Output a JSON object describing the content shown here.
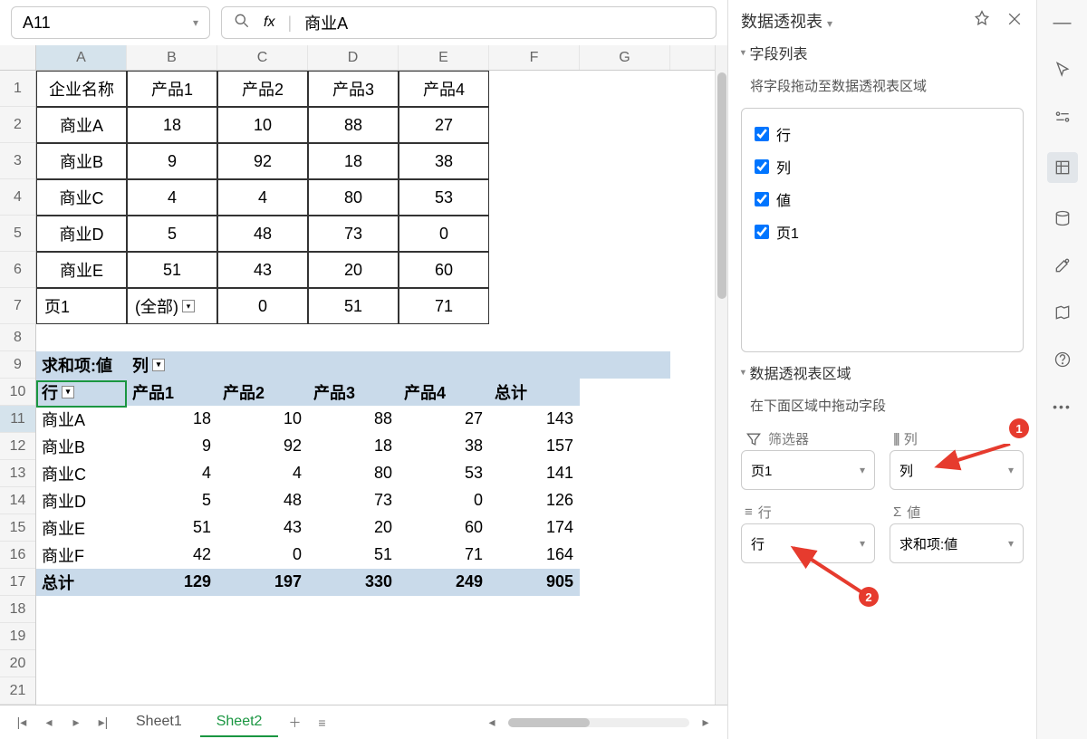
{
  "toolbar": {
    "cell_ref": "A11",
    "fx_label": "fx",
    "formula_value": "商业A"
  },
  "columns": [
    "A",
    "B",
    "C",
    "D",
    "E",
    "F",
    "G"
  ],
  "row_count": 22,
  "selected_row": 11,
  "selected_col_index": 0,
  "data_table": {
    "header": [
      "企业名称",
      "产品1",
      "产品2",
      "产品3",
      "产品4"
    ],
    "rows": [
      [
        "商业A",
        "18",
        "10",
        "88",
        "27"
      ],
      [
        "商业B",
        "9",
        "92",
        "18",
        "38"
      ],
      [
        "商业C",
        "4",
        "4",
        "80",
        "53"
      ],
      [
        "商业D",
        "5",
        "48",
        "73",
        "0"
      ],
      [
        "商业E",
        "51",
        "43",
        "20",
        "60"
      ]
    ],
    "page_label": "页1",
    "page_value": "(全部)",
    "extra_row": [
      "0",
      "51",
      "71"
    ]
  },
  "pivot": {
    "sum_label": "求和项:値",
    "col_label": "列",
    "row_label": "行",
    "col_headers": [
      "产品1",
      "产品2",
      "产品3",
      "产品4",
      "总计"
    ],
    "rows": [
      [
        "商业A",
        "18",
        "10",
        "88",
        "27",
        "143"
      ],
      [
        "商业B",
        "9",
        "92",
        "18",
        "38",
        "157"
      ],
      [
        "商业C",
        "4",
        "4",
        "80",
        "53",
        "141"
      ],
      [
        "商业D",
        "5",
        "48",
        "73",
        "0",
        "126"
      ],
      [
        "商业E",
        "51",
        "43",
        "20",
        "60",
        "174"
      ],
      [
        "商业F",
        "42",
        "0",
        "51",
        "71",
        "164"
      ]
    ],
    "total_label": "总计",
    "totals": [
      "129",
      "197",
      "330",
      "249",
      "905"
    ]
  },
  "tabs": {
    "items": [
      "Sheet1",
      "Sheet2"
    ],
    "active": 1
  },
  "panel": {
    "title": "数据透视表",
    "field_section": "字段列表",
    "field_hint": "将字段拖动至数据透视表区域",
    "fields": [
      "行",
      "列",
      "値",
      "页1"
    ],
    "area_section": "数据透视表区域",
    "area_hint": "在下面区域中拖动字段",
    "areas": {
      "filter_label": "筛选器",
      "filter_value": "页1",
      "col_label": "列",
      "col_value": "列",
      "row_label": "行",
      "row_value": "行",
      "val_label": "値",
      "val_value": "求和项:値"
    },
    "badges": [
      "1",
      "2"
    ]
  }
}
